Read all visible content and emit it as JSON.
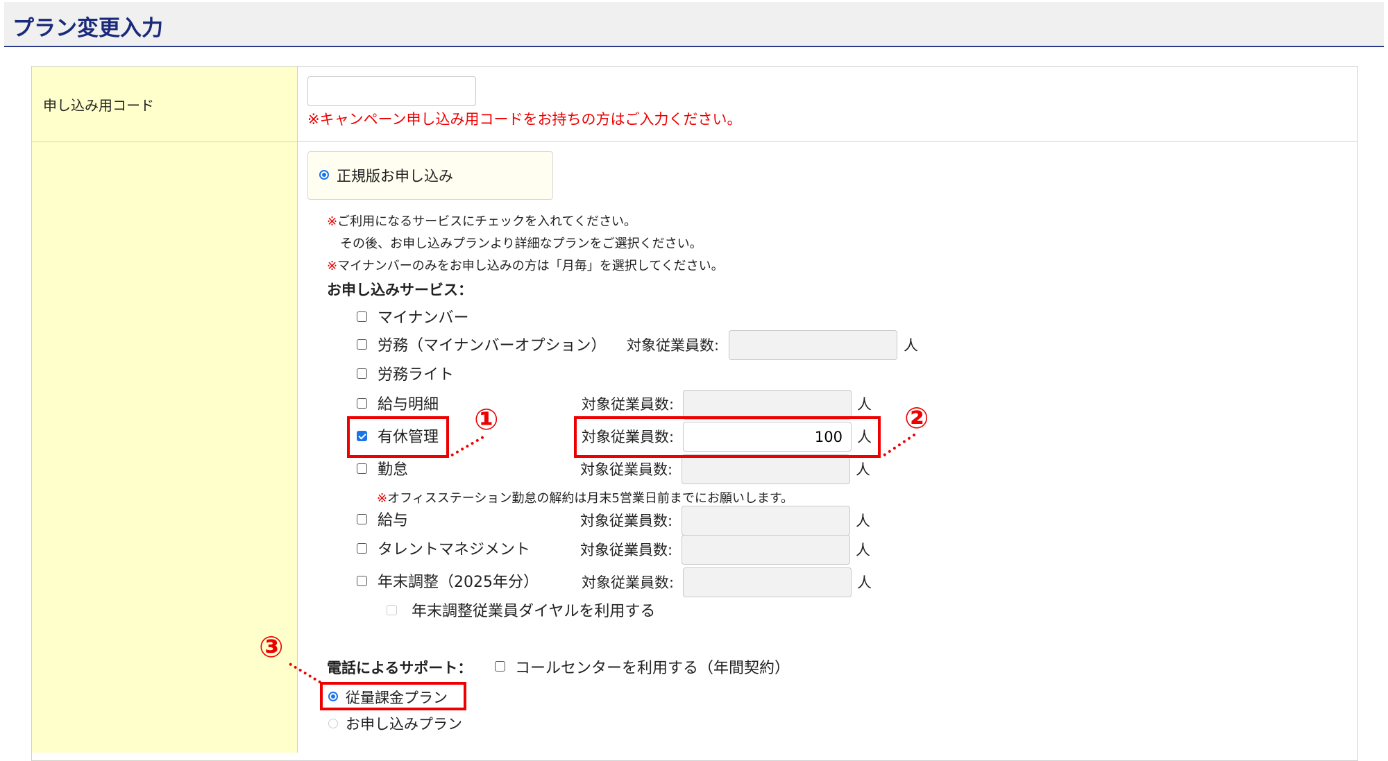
{
  "page": {
    "title": "プラン変更入力"
  },
  "code_row": {
    "label": "申し込み用コード",
    "input_value": "",
    "notice": "※キャンペーン申し込み用コードをお持ちの方はご入力ください。"
  },
  "plan_type": {
    "option_label": "正規版お申し込み",
    "selected": true
  },
  "instructions": {
    "mark": "※",
    "line1": "ご利用になるサービスにチェックを入れてください。",
    "line2": "その後、お申し込みプランより詳細なプランをご選択ください。",
    "line3": "マイナンバーのみをお申し込みの方は「月毎」を選択してください。"
  },
  "services": {
    "heading": "お申し込みサービス：",
    "count_label": "対象従業員数:",
    "unit": "人",
    "items": [
      {
        "label": "マイナンバー",
        "checked": false
      },
      {
        "label": "労務（マイナンバーオプション）",
        "checked": false,
        "count": ""
      },
      {
        "label": "労務ライト",
        "checked": false
      },
      {
        "label": "給与明細",
        "checked": false,
        "count": ""
      },
      {
        "label": "有休管理",
        "checked": true,
        "count": "100"
      },
      {
        "label": "勤怠",
        "checked": false,
        "count": ""
      },
      {
        "label": "給与",
        "checked": false,
        "count": ""
      },
      {
        "label": "タレントマネジメント",
        "checked": false,
        "count": ""
      },
      {
        "label": "年末調整（2025年分）",
        "checked": false,
        "count": ""
      }
    ],
    "kintai_note": "オフィスステーション勤怠の解約は月末5営業日前までにお願いします。",
    "yearend_dial": {
      "label": "年末調整従業員ダイヤルを利用する",
      "checked": false,
      "disabled": true
    }
  },
  "phone_support": {
    "label": "電話によるサポート：",
    "callcenter_label": "コールセンターを利用する（年間契約）",
    "callcenter_checked": false
  },
  "billing": {
    "options": [
      {
        "label": "従量課金プラン",
        "selected": true
      },
      {
        "label": "お申し込みプラン",
        "selected": false
      }
    ]
  },
  "annotations": {
    "a1": "①",
    "a2": "②",
    "a3": "③"
  },
  "colors": {
    "highlight": "#ee0000",
    "label_bg": "#ffffcc",
    "title": "#1a2a7a",
    "accent": "#1a73e8"
  }
}
